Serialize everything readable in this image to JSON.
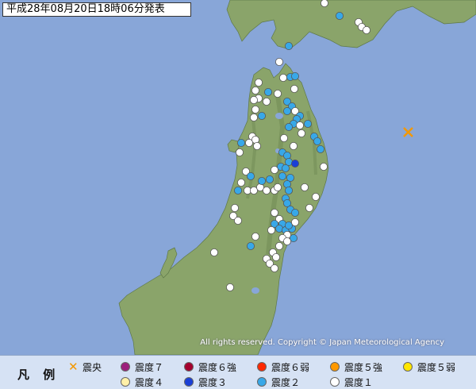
{
  "header": {
    "title": "平成28年08月20日18時06分発表"
  },
  "map": {
    "copyright": "All rights reserved. Copyright © Japan Meteorological Agency",
    "colors": {
      "sea": "#88a6d8",
      "land": "#8aa46a",
      "land_dark": "#6f8a54",
      "epicenter": "#f39800"
    }
  },
  "legend": {
    "title": "凡 例",
    "items": [
      {
        "key": "epicenter",
        "label": "震央",
        "icon": "cross-icon",
        "color": "#f39800"
      },
      {
        "key": "int7",
        "label": "震度７",
        "icon": "dot-icon",
        "color": "#9c1f7c"
      },
      {
        "key": "int6p",
        "label": "震度６強",
        "icon": "dot-icon",
        "color": "#a4002e"
      },
      {
        "key": "int6m",
        "label": "震度６弱",
        "icon": "dot-icon",
        "color": "#ff2800"
      },
      {
        "key": "int5p",
        "label": "震度５強",
        "icon": "dot-icon",
        "color": "#ff9900"
      },
      {
        "key": "int5m",
        "label": "震度５弱",
        "icon": "dot-icon",
        "color": "#ffe600"
      },
      {
        "key": "int4",
        "label": "震度４",
        "icon": "dot-icon",
        "color": "#fff0a8"
      },
      {
        "key": "int3",
        "label": "震度３",
        "icon": "dot-icon",
        "color": "#1a3fd6"
      },
      {
        "key": "int2",
        "label": "震度２",
        "icon": "dot-icon",
        "color": "#38a8e8"
      },
      {
        "key": "int1",
        "label": "震度１",
        "icon": "dot-icon",
        "color": "#ffffff"
      }
    ]
  }
}
